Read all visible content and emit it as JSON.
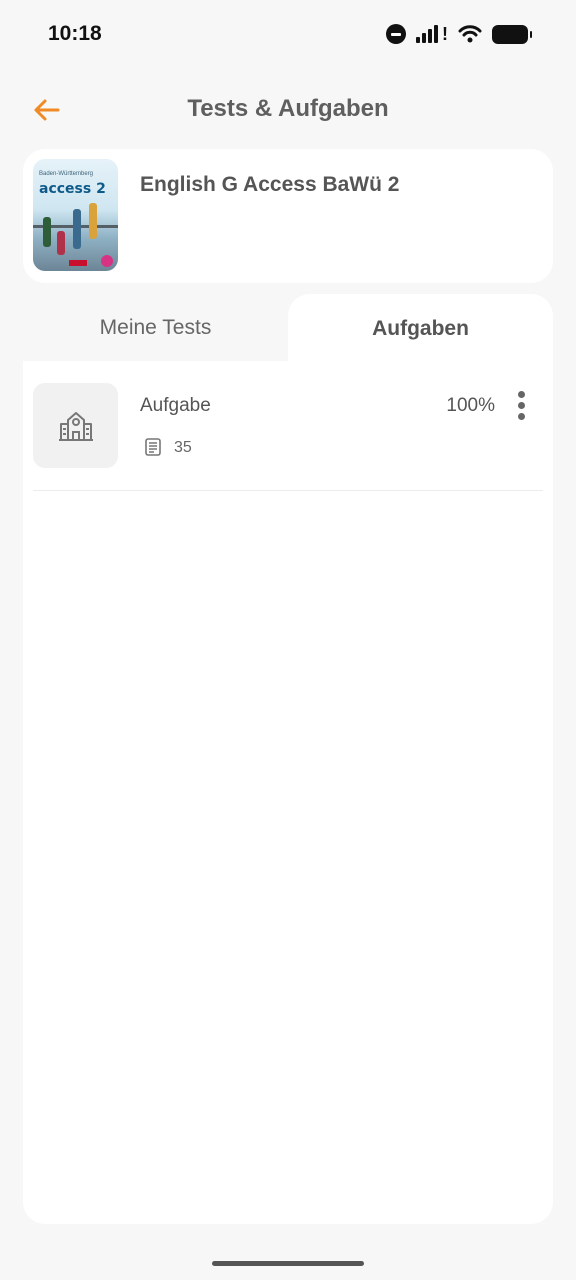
{
  "status_bar": {
    "time": "10:18",
    "icons": [
      "do-not-disturb-icon",
      "cellular-signal-icon",
      "wifi-icon",
      "battery-icon"
    ]
  },
  "header": {
    "back_icon": "arrow-left-icon",
    "title": "Tests & Aufgaben"
  },
  "book": {
    "cover_series": "Baden-Württemberg",
    "cover_title": "access 2",
    "title": "English G Access BaWü 2"
  },
  "tabs": [
    {
      "label": "Meine Tests",
      "active": false
    },
    {
      "label": "Aufgaben",
      "active": true
    }
  ],
  "tasks": [
    {
      "thumb_icon": "school-building-icon",
      "title": "Aufgabe",
      "count_icon": "document-list-icon",
      "count": "35",
      "percent": "100%",
      "menu_icon": "more-vertical-icon"
    }
  ],
  "colors": {
    "accent": "#f08a24",
    "background": "#f7f7f7",
    "card": "#ffffff",
    "text": "#555555"
  }
}
